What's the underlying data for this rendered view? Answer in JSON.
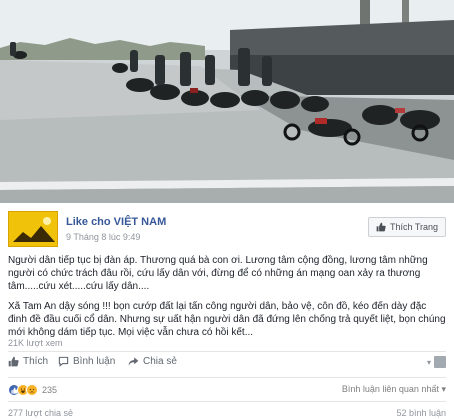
{
  "post": {
    "page_name": "Like cho VIỆT NAM",
    "timestamp": "9 Tháng 8 lúc 9:49",
    "like_page_label": "Thích Trang",
    "paragraphs": [
      "Người dân tiếp tục bị đàn áp. Thương quá bà con ơi. Lương tâm cộng đồng, lương tâm những người có chức trách đâu rồi, cứu lấy dân với, đừng để có những án mạng oan xảy ra thương tâm.....cứu xét.....cứu lấy dân....",
      "Xã Tam An dậy sóng !!! bọn cướp đất lại tấn công người dân, bảo vệ, côn đồ, kéo đến dày đặc đinh đề đầu cuối cổ dân. Nhưng sự uất hận người dân đã đứng lên chống trả quyết liệt, bọn chúng mới không dám tiếp tục. Mọi việc vẫn chưa có hồi kết..."
    ],
    "view_count": "21K lượt xem",
    "actions": {
      "like": "Thích",
      "comment": "Bình luận",
      "share": "Chia sẻ"
    },
    "reaction_count": "235",
    "sort_comments": "Bình luận liên quan nhất",
    "share_count": "277 lượt chia sẻ",
    "comment_count": "52 bình luận"
  },
  "icons": {
    "like": "thumbs-up-icon",
    "comment": "speech-bubble-icon",
    "share": "share-arrow-icon",
    "sort": "chevron-down-icon"
  },
  "colors": {
    "link": "#365899",
    "muted": "#90949c",
    "avatar_bg": "#f0c20a",
    "like_blue": "#4267b2",
    "love_red": "#f25268",
    "haha_yellow": "#f7b125"
  }
}
